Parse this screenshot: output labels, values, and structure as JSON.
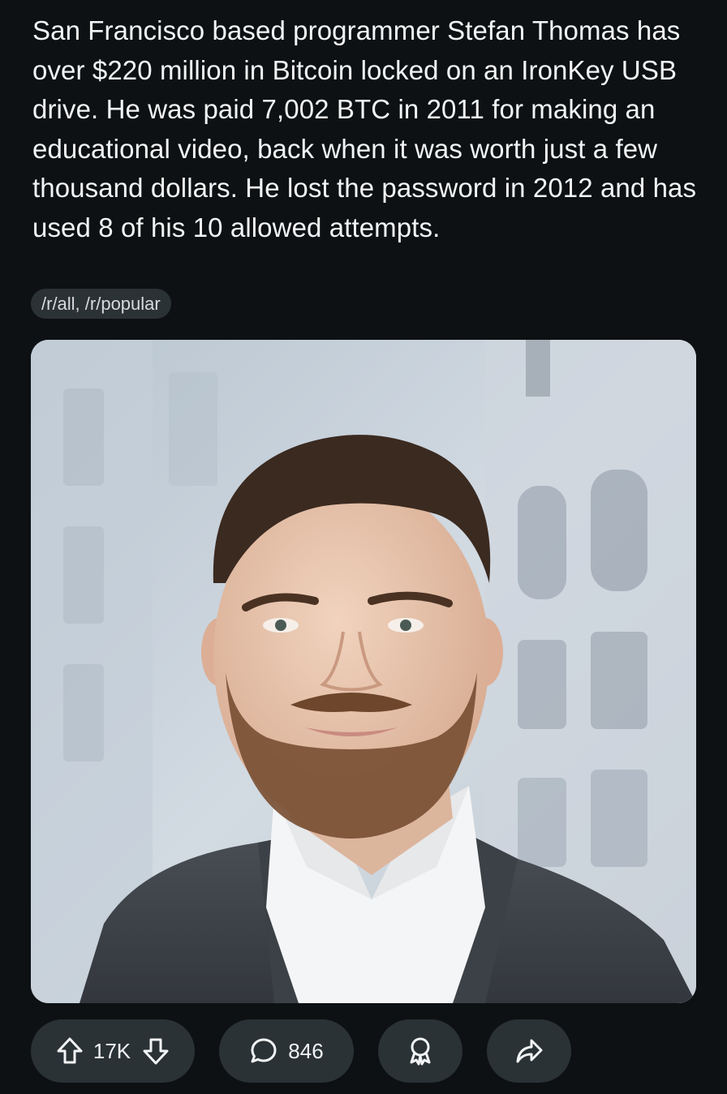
{
  "post": {
    "title": "San Francisco based programmer Stefan Thomas has over $220 million in Bitcoin locked on an IronKey USB drive. He was paid 7,002 BTC in 2011 for making an educational video, back when it was worth just a few thousand dollars. He lost the password in 2012 and has used 8 of his 10 allowed attempts.",
    "flair": "/r/all, /r/popular"
  },
  "actions": {
    "vote_count": "17K",
    "comment_count": "846"
  },
  "icons": {
    "upvote": "upvote-arrow-icon",
    "downvote": "downvote-arrow-icon",
    "comment": "comment-bubble-icon",
    "award": "award-icon",
    "share": "share-arrow-icon"
  },
  "colors": {
    "background": "#0e1113",
    "pill": "#2a3236",
    "flair_bg": "#2b3236",
    "text": "#f2f4f5"
  }
}
